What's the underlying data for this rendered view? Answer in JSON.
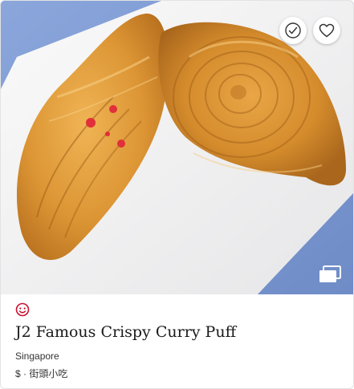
{
  "listing": {
    "photo_alt": "Curry puffs",
    "name": "J2 Famous Crispy Curry Puff",
    "location": "Singapore",
    "price": "$",
    "separator": "·",
    "cuisine": "街頭小吃"
  },
  "icons": {
    "visited": "check-circle-icon",
    "save": "heart-icon",
    "gallery": "gallery-icon",
    "distinction": "bib-gourmand-icon"
  },
  "colors": {
    "michelin_red": "#c8102e",
    "table_blue": "#7f9bd4",
    "plate_white": "#f3f3f3",
    "pastry_gold": "#d9952e"
  }
}
